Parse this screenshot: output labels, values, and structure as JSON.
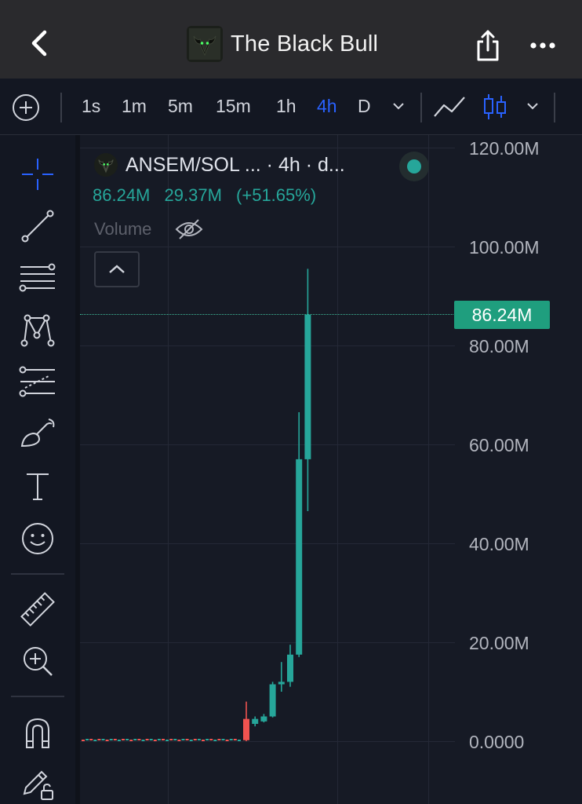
{
  "header": {
    "title": "The Black Bull",
    "icons": [
      "back-arrow-icon",
      "bull-logo-icon",
      "share-icon",
      "more-icon"
    ]
  },
  "toolbar": {
    "timeframes": [
      {
        "label": "1s",
        "active": false
      },
      {
        "label": "1m",
        "active": false
      },
      {
        "label": "5m",
        "active": false
      },
      {
        "label": "15m",
        "active": false
      },
      {
        "label": "1h",
        "active": false
      },
      {
        "label": "4h",
        "active": true
      },
      {
        "label": "D",
        "active": false
      }
    ],
    "active_color": "#2962ff"
  },
  "left_tools": [
    "crosshair-icon",
    "trend-line-icon",
    "fib-lines-icon",
    "pattern-icon",
    "prediction-icon",
    "brush-icon",
    "text-icon",
    "emoji-icon",
    "ruler-icon",
    "zoom-in-icon",
    "magnet-icon",
    "lock-draw-icon"
  ],
  "legend": {
    "symbol": "ANSEM/SOL ... · 4h · d...",
    "close": "86.24M",
    "change": "29.37M",
    "change_pct": "(+51.65%)",
    "volume_label": "Volume",
    "status_color": "#26a69a"
  },
  "price_tag": {
    "label": "86.24M",
    "color": "#1f9e7e"
  },
  "chart_data": {
    "type": "candlestick",
    "y_ticks": [
      "120.00M",
      "100.00M",
      "80.00M",
      "60.00M",
      "40.00M",
      "20.00M",
      "0.0000"
    ],
    "ylim": [
      0,
      120
    ],
    "y_unit": "M",
    "up_color": "#26a69a",
    "down_color": "#ef5350",
    "last_price": 86.24,
    "candles": [
      {
        "o": 4.5,
        "h": 8.0,
        "l": 0.0,
        "c": 0.2
      },
      {
        "o": 3.5,
        "h": 5.0,
        "l": 3.0,
        "c": 4.5
      },
      {
        "o": 4.0,
        "h": 5.5,
        "l": 3.8,
        "c": 5.0
      },
      {
        "o": 5.0,
        "h": 12.0,
        "l": 4.8,
        "c": 11.5
      },
      {
        "o": 11.5,
        "h": 16.0,
        "l": 10.0,
        "c": 12.0
      },
      {
        "o": 12.0,
        "h": 19.5,
        "l": 11.0,
        "c": 17.5
      },
      {
        "o": 17.5,
        "h": 66.5,
        "l": 17.0,
        "c": 57.0
      },
      {
        "o": 57.0,
        "h": 95.5,
        "l": 46.5,
        "c": 86.24
      }
    ]
  }
}
